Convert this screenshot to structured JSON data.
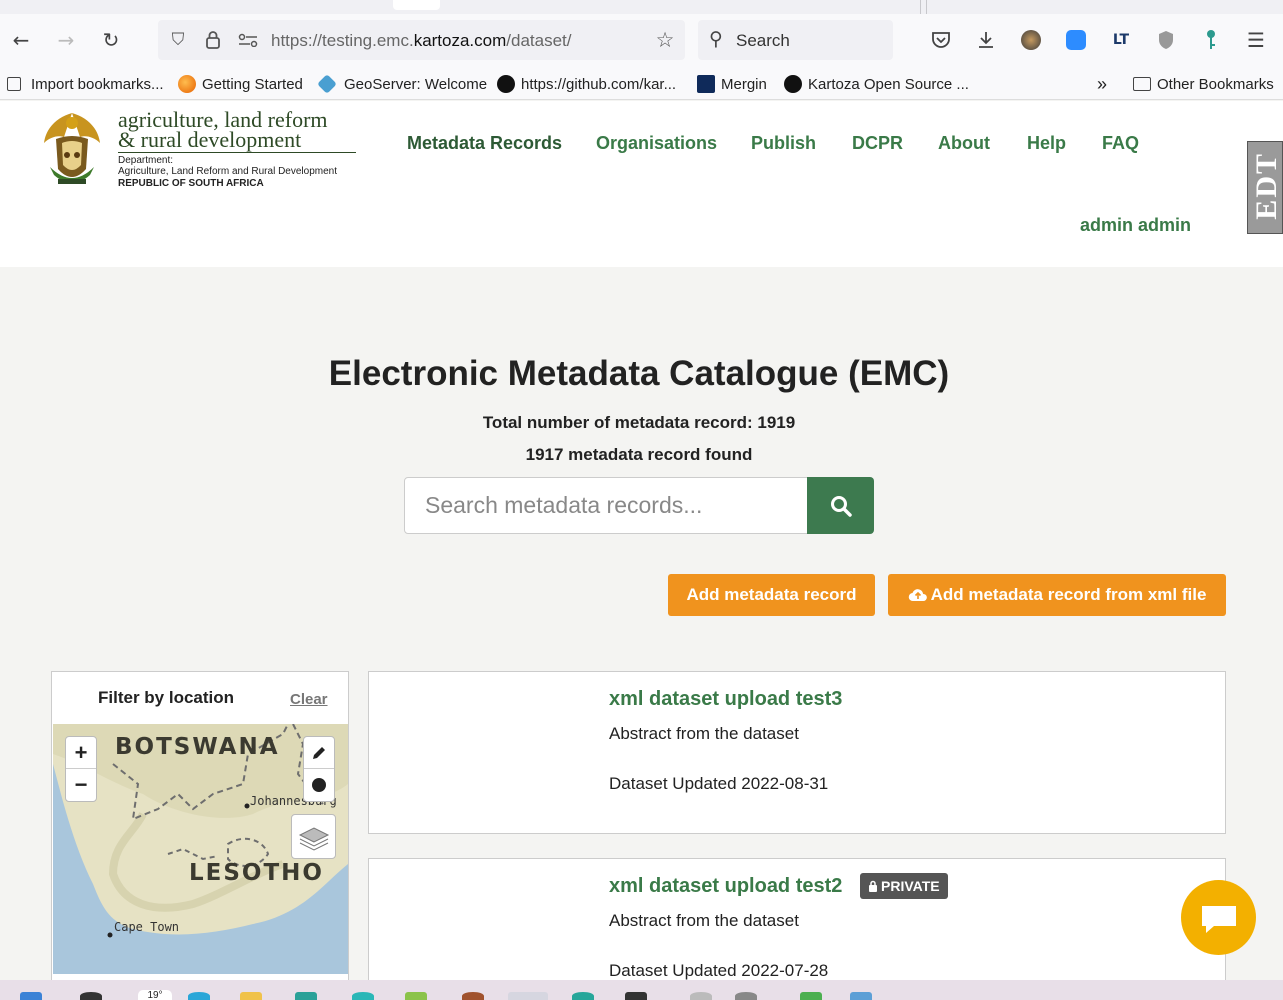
{
  "browser": {
    "url_prefix": "https://testing.emc.",
    "url_domain": "kartoza.com",
    "url_suffix": "/dataset/",
    "search_label": "Search",
    "bookmarks": [
      {
        "label": "Import bookmarks...",
        "icon": "import-icon"
      },
      {
        "label": "Getting Started",
        "icon": "firefox-icon"
      },
      {
        "label": "GeoServer: Welcome",
        "icon": "geoserver-icon"
      },
      {
        "label": "https://github.com/kar...",
        "icon": "github-icon"
      },
      {
        "label": "Mergin",
        "icon": "mergin-icon"
      },
      {
        "label": "Kartoza Open Source ...",
        "icon": "github-icon"
      }
    ],
    "other_bookmarks": "Other Bookmarks"
  },
  "brand": {
    "line1": "agriculture, land reform",
    "line2": "& rural development",
    "dept": "Department:",
    "dept_name": "Agriculture, Land Reform and Rural Development",
    "country": "REPUBLIC OF SOUTH AFRICA"
  },
  "nav": [
    "Metadata Records",
    "Organisations",
    "Publish",
    "DCPR",
    "About",
    "Help",
    "FAQ"
  ],
  "user": "admin admin",
  "edt_tab": "EDT",
  "main": {
    "title": "Electronic Metadata Catalogue (EMC)",
    "total": "Total number of metadata record: 1919",
    "found": "1917 metadata record found",
    "search_placeholder": "Search metadata records...",
    "add_button": "Add metadata record",
    "add_xml_button": "Add metadata record from xml file"
  },
  "filter": {
    "title": "Filter by location",
    "clear": "Clear",
    "map_labels": {
      "botswana": "BOTSWANA",
      "lesotho": "LESOTHO",
      "johannesburg": "Johannesburg",
      "cape_town": "Cape Town"
    },
    "zoom_in": "+",
    "zoom_out": "−"
  },
  "records": [
    {
      "title": "xml dataset upload test3",
      "abstract": "Abstract from the dataset",
      "updated": "Dataset Updated 2022-08-31",
      "badge": ""
    },
    {
      "title": "xml dataset upload test2",
      "abstract": "Abstract from the dataset",
      "updated": "Dataset Updated 2022-07-28",
      "badge": "PRIVATE"
    }
  ],
  "colors": {
    "accent_green": "#3a7a48",
    "accent_orange": "#f0931e",
    "chat_yellow": "#f3b000"
  },
  "taskbar": {
    "weather": "19°"
  }
}
